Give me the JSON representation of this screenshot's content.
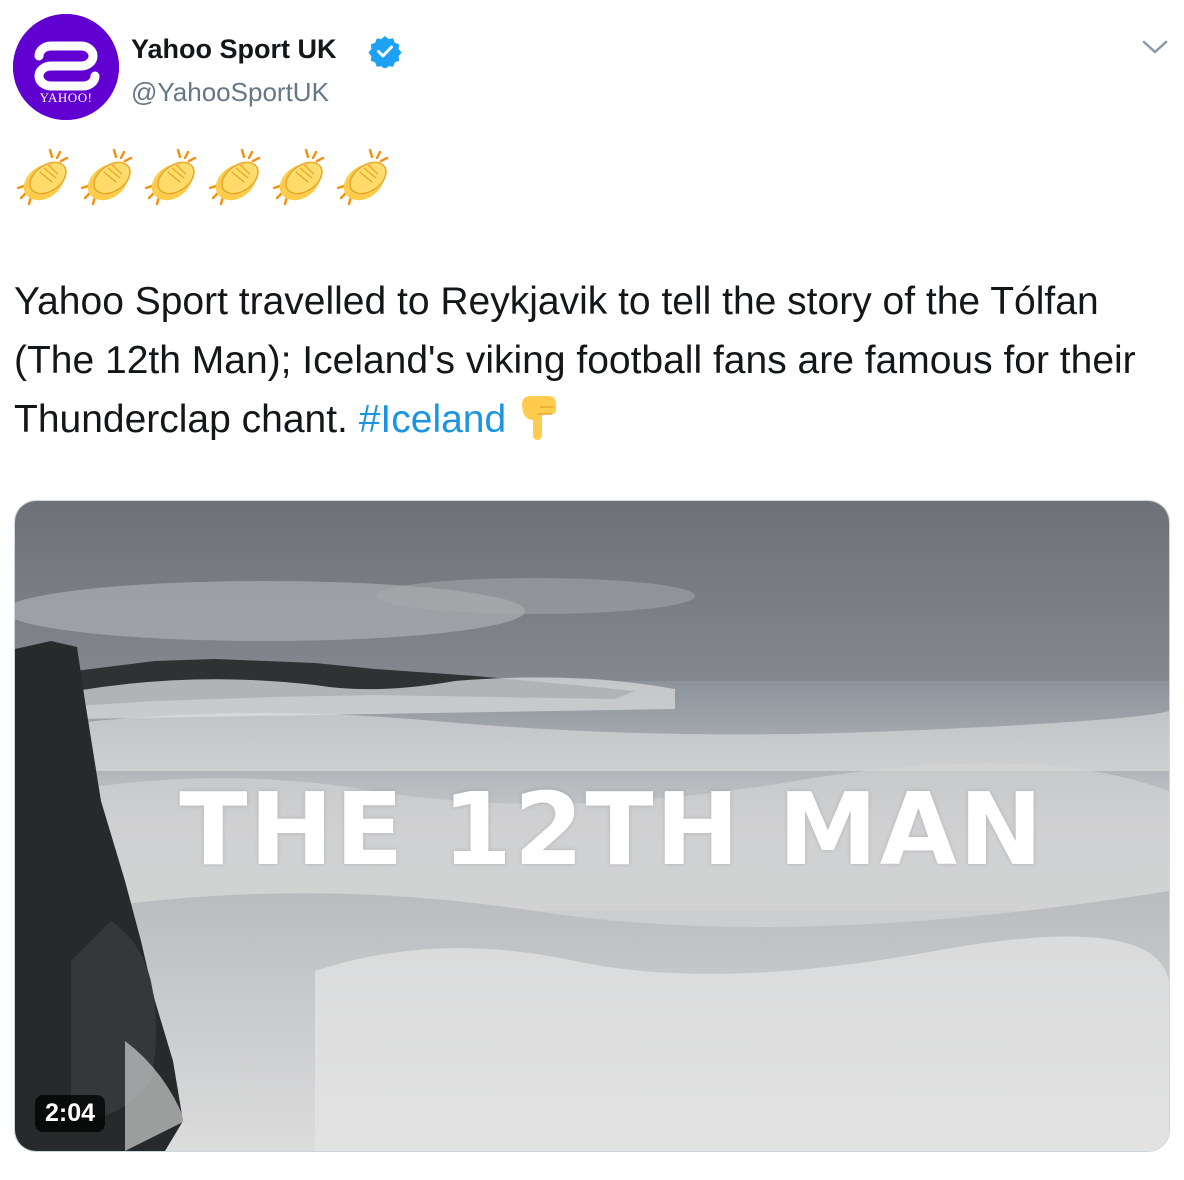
{
  "header": {
    "avatar_label": "YAHOO!",
    "display_name": "Yahoo Sport UK",
    "handle": "@YahooSportUK"
  },
  "tweet": {
    "emoji": "👏👏👏👏👏👏",
    "text": "Yahoo Sport travelled to Reykjavik to tell the story of the Tólfan (The 12th Man); Iceland's viking football fans are famous for their Thunderclap chant.",
    "hashtag": "#Iceland"
  },
  "media": {
    "title": "THE 12TH MAN",
    "duration": "2:04"
  },
  "icons": {
    "verified": "verified-badge-icon",
    "menu": "chevron-down-icon",
    "clap": "clapping-hands-emoji",
    "point": "backhand-index-pointing-down-emoji"
  },
  "colors": {
    "brand_purple": "#6001d2",
    "hashtag_blue": "#1b95e0",
    "verified_blue": "#1da1f2",
    "handle_gray": "#657786"
  }
}
